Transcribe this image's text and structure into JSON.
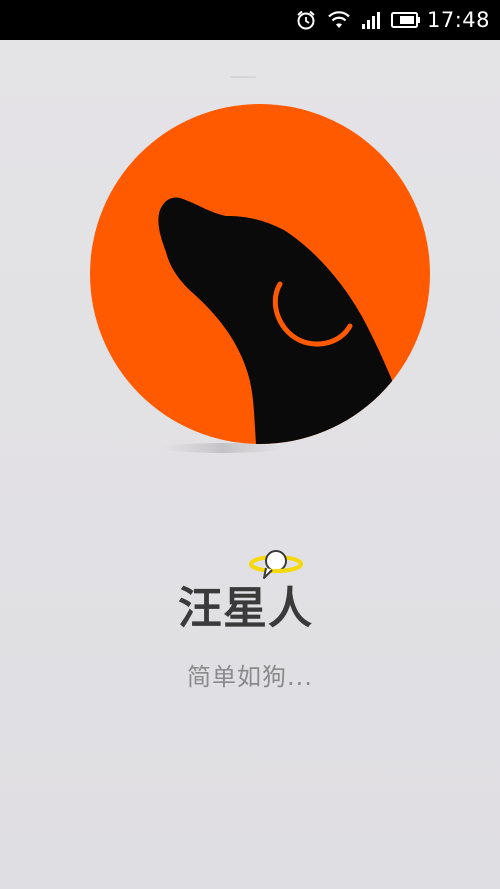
{
  "status_bar": {
    "time": "17:48",
    "icons": [
      "alarm-icon",
      "wifi-icon",
      "signal-icon",
      "battery-icon"
    ]
  },
  "splash": {
    "app_name": "汪星人",
    "tagline": "简单如狗...",
    "logo_icon": "dog-head-icon",
    "badge_icon": "planet-icon",
    "colors": {
      "logo_orange": "#ff5a00",
      "dog_black": "#0a0a0a",
      "collar_orange": "#ff5a00",
      "planet_yellow": "#f5d90a",
      "background": "#e2e1e4",
      "title_text": "#3a3a3a",
      "tagline_text": "#8a8a8c"
    }
  }
}
